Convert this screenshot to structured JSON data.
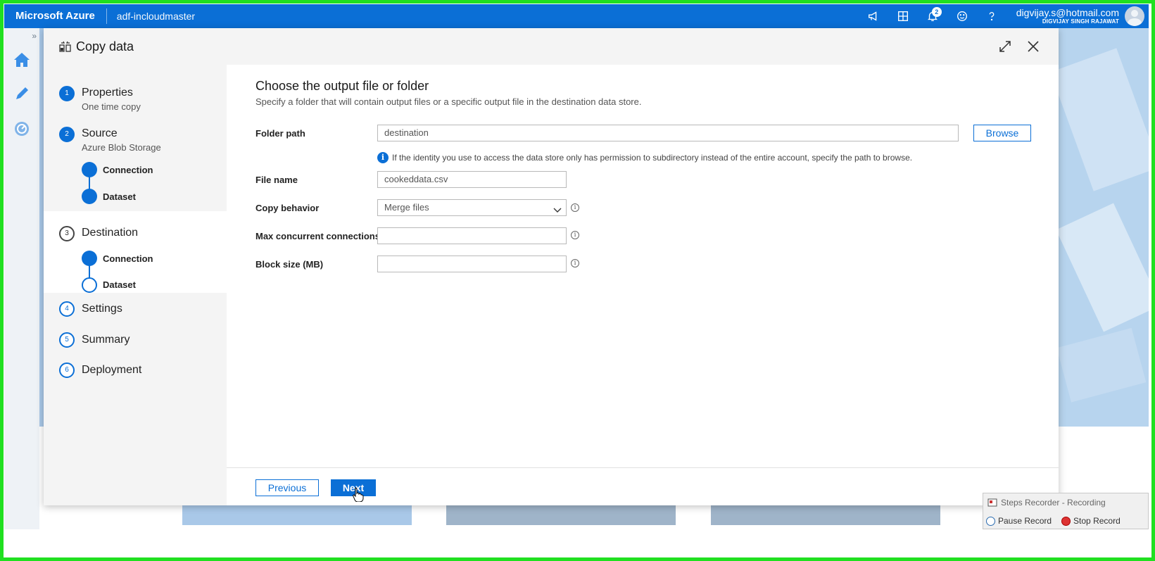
{
  "topbar": {
    "brand": "Microsoft Azure",
    "factory": "adf-incloudmaster",
    "notification_count": "2",
    "user_email": "digvijay.s@hotmail.com",
    "user_name": "DIGVIJAY SINGH RAJAWAT"
  },
  "dialog": {
    "title": "Copy data"
  },
  "steps": [
    {
      "num": "1",
      "label": "Properties",
      "sub": "One time copy"
    },
    {
      "num": "2",
      "label": "Source",
      "sub": "Azure Blob Storage",
      "children": [
        "Connection",
        "Dataset"
      ]
    },
    {
      "num": "3",
      "label": "Destination",
      "children": [
        "Connection",
        "Dataset"
      ]
    },
    {
      "num": "4",
      "label": "Settings"
    },
    {
      "num": "5",
      "label": "Summary"
    },
    {
      "num": "6",
      "label": "Deployment"
    }
  ],
  "content": {
    "title": "Choose the output file or folder",
    "description": "Specify a folder that will contain output files or a specific output file in the destination data store.",
    "folder_path_label": "Folder path",
    "folder_path_value": "destination",
    "browse_label": "Browse",
    "hint": "If the identity you use to access the data store only has permission to subdirectory instead of the entire account, specify the path to browse.",
    "file_name_label": "File name",
    "file_name_value": "cookeddata.csv",
    "copy_behavior_label": "Copy behavior",
    "copy_behavior_value": "Merge files",
    "max_conn_label": "Max concurrent connections",
    "max_conn_value": "",
    "block_size_label": "Block size (MB)",
    "block_size_value": ""
  },
  "footer": {
    "previous_label": "Previous",
    "next_label": "Next"
  },
  "recorder": {
    "title": "Steps Recorder - Recording",
    "pause_label": "Pause Record",
    "stop_label": "Stop Record"
  },
  "colors": {
    "accent": "#0b6fd6",
    "frame": "#20e020"
  }
}
